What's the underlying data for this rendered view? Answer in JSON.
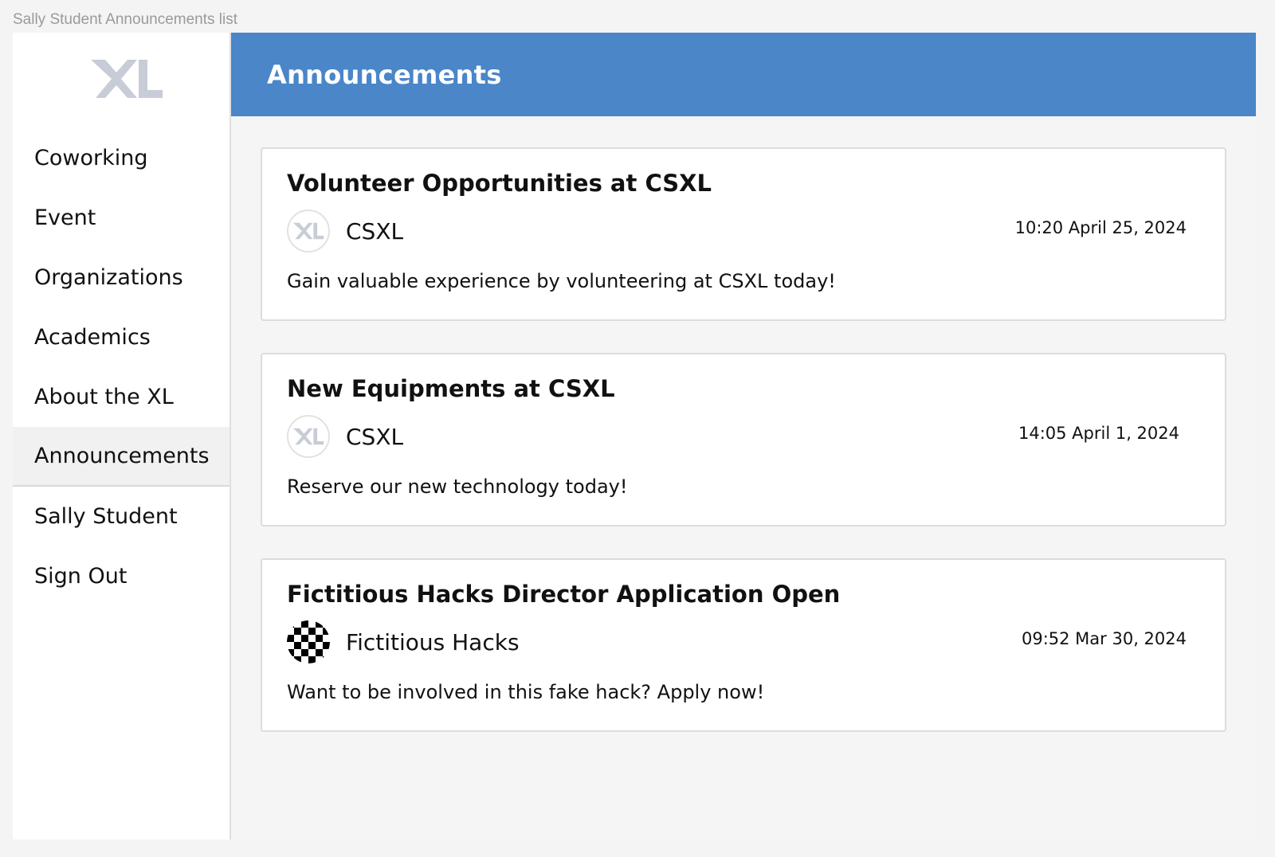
{
  "window": {
    "caption": "Sally Student Announcements list"
  },
  "sidebar": {
    "logo": "xl-logo",
    "items": [
      {
        "label": "Coworking",
        "active": false
      },
      {
        "label": "Event",
        "active": false
      },
      {
        "label": "Organizations",
        "active": false
      },
      {
        "label": "Academics",
        "active": false
      },
      {
        "label": "About the XL",
        "active": false
      },
      {
        "label": "Announcements",
        "active": true
      },
      {
        "label": "Sally Student",
        "active": false
      },
      {
        "label": "Sign Out",
        "active": false
      }
    ]
  },
  "header": {
    "title": "Announcements",
    "color": "#4a86c8"
  },
  "announcements": [
    {
      "title": "Volunteer Opportunities at CSXL",
      "org": "CSXL",
      "org_icon": "xl-logo",
      "timestamp": "10:20 April 25, 2024",
      "body": "Gain valuable experience by volunteering at CSXL today!"
    },
    {
      "title": "New Equipments at CSXL",
      "org": "CSXL",
      "org_icon": "xl-logo",
      "timestamp": "14:05 April 1, 2024",
      "body": "Reserve our new technology today!"
    },
    {
      "title": "Fictitious Hacks Director Application Open",
      "org": "Fictitious Hacks",
      "org_icon": "checkerboard-logo",
      "timestamp": "09:52 Mar 30, 2024",
      "body": "Want to be involved in this fake hack? Apply now!"
    }
  ]
}
